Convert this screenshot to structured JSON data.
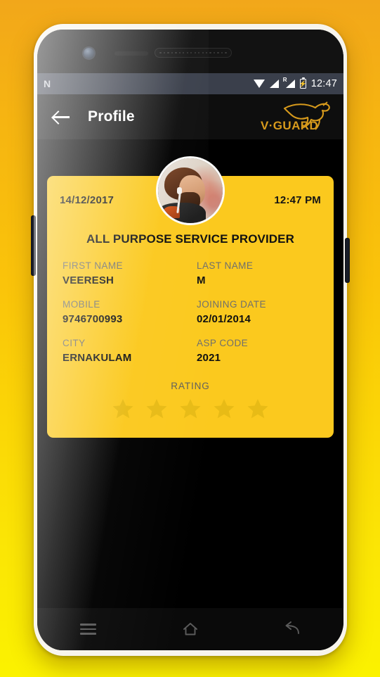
{
  "statusbar": {
    "notification_icon": "n-notification-icon",
    "wifi_icon": "wifi-icon",
    "signal_icon": "signal-icon",
    "roaming_label": "R",
    "roaming_icon": "roaming-signal-icon",
    "battery_icon": "battery-charging-icon",
    "battery_bolt": "⚡",
    "time": "12:47"
  },
  "toolbar": {
    "back_icon": "back-arrow-icon",
    "title": "Profile",
    "brand": "V·GUARD",
    "brand_icon": "vguard-kangaroo-logo"
  },
  "card": {
    "date": "14/12/2017",
    "time": "12:47 PM",
    "title": "ALL PURPOSE SERVICE PROVIDER",
    "fields": [
      {
        "label": "FIRST NAME",
        "value": "VEERESH"
      },
      {
        "label": "LAST NAME",
        "value": "M"
      },
      {
        "label": "MOBILE",
        "value": "9746700993"
      },
      {
        "label": "JOINING DATE",
        "value": "02/01/2014"
      },
      {
        "label": "CITY",
        "value": "ERNAKULAM"
      },
      {
        "label": "ASP CODE",
        "value": "2021"
      }
    ],
    "rating_label": "RATING",
    "rating_stars": 5,
    "rating_value": 0
  },
  "avatar": {
    "name": "profile-avatar-photo"
  },
  "navbar": {
    "recents_icon": "recents-menu-icon",
    "home_icon": "home-icon",
    "back_icon": "back-icon"
  },
  "colors": {
    "card_yellow": "#fbc91e",
    "star_gold": "#e8bb16",
    "brand_gold": "#d79a1c",
    "label_gray": "#6f6f6c",
    "statusbar": "#3a3f4b",
    "bg_top": "#f2a71a",
    "bg_bottom": "#fbf200"
  }
}
